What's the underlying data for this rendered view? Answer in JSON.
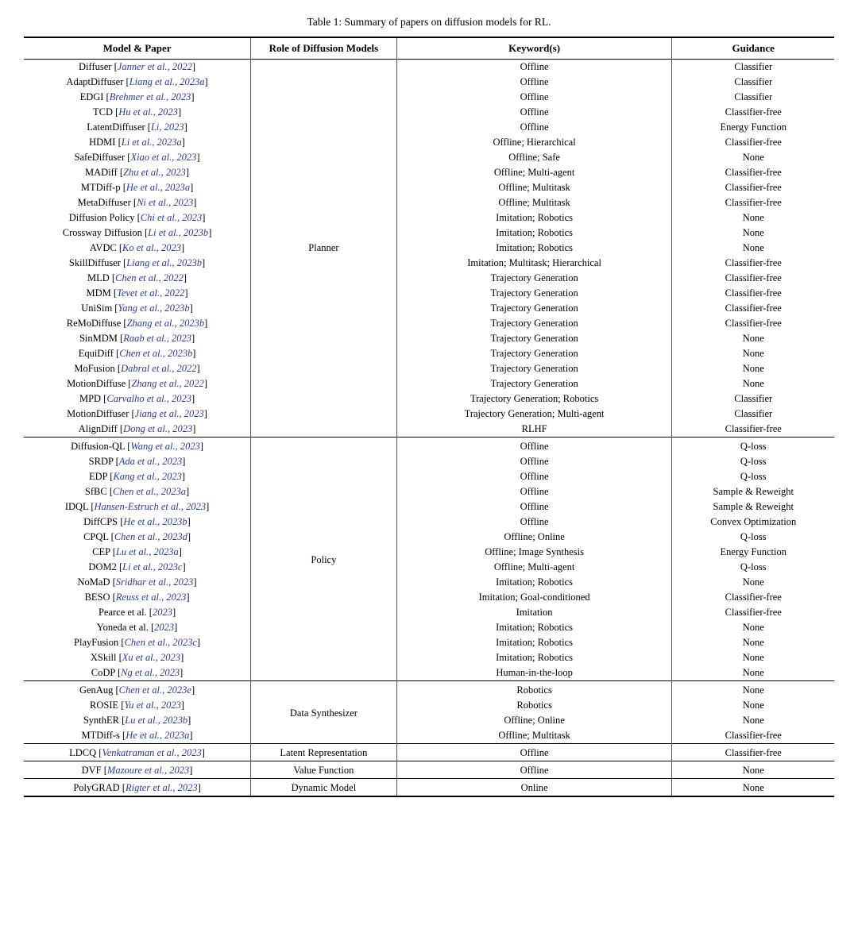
{
  "title": "Table 1: Summary of papers on diffusion models for RL.",
  "headers": {
    "model": "Model & Paper",
    "role": "Role of Diffusion Models",
    "keywords": "Keyword(s)",
    "guidance": "Guidance"
  },
  "sections": [
    {
      "role": "Planner",
      "rows": [
        {
          "model": "Diffuser [Janner et al., 2022]",
          "keywords": "Offline",
          "guidance": "Classifier"
        },
        {
          "model": "AdaptDiffuser [Liang et al., 2023a]",
          "keywords": "Offline",
          "guidance": "Classifier"
        },
        {
          "model": "EDGI [Brehmer et al., 2023]",
          "keywords": "Offline",
          "guidance": "Classifier"
        },
        {
          "model": "TCD [Hu et al., 2023]",
          "keywords": "Offline",
          "guidance": "Classifier-free"
        },
        {
          "model": "LatentDiffuser [Li, 2023]",
          "keywords": "Offline",
          "guidance": "Energy Function"
        },
        {
          "model": "HDMI [Li et al., 2023a]",
          "keywords": "Offline; Hierarchical",
          "guidance": "Classifier-free"
        },
        {
          "model": "SafeDiffuser [Xiao et al., 2023]",
          "keywords": "Offline; Safe",
          "guidance": "None"
        },
        {
          "model": "MADiff [Zhu et al., 2023]",
          "keywords": "Offline; Multi-agent",
          "guidance": "Classifier-free"
        },
        {
          "model": "MTDiff-p [He et al., 2023a]",
          "keywords": "Offline; Multitask",
          "guidance": "Classifier-free"
        },
        {
          "model": "MetaDiffuser [Ni et al., 2023]",
          "keywords": "Offline; Multitask",
          "guidance": "Classifier-free"
        },
        {
          "model": "Diffusion Policy [Chi et al., 2023]",
          "keywords": "Imitation; Robotics",
          "guidance": "None"
        },
        {
          "model": "Crossway Diffusion [Li et al., 2023b]",
          "keywords": "Imitation; Robotics",
          "guidance": "None"
        },
        {
          "model": "AVDC [Ko et al., 2023]",
          "keywords": "Imitation; Robotics",
          "guidance": "None"
        },
        {
          "model": "SkillDiffuser [Liang et al., 2023b]",
          "keywords": "Imitation; Multitask; Hierarchical",
          "guidance": "Classifier-free"
        },
        {
          "model": "MLD [Chen et al., 2022]",
          "keywords": "Trajectory Generation",
          "guidance": "Classifier-free"
        },
        {
          "model": "MDM [Tevet et al., 2022]",
          "keywords": "Trajectory Generation",
          "guidance": "Classifier-free"
        },
        {
          "model": "UniSim [Yang et al., 2023b]",
          "keywords": "Trajectory Generation",
          "guidance": "Classifier-free"
        },
        {
          "model": "ReMoDiffuse [Zhang et al., 2023b]",
          "keywords": "Trajectory Generation",
          "guidance": "Classifier-free"
        },
        {
          "model": "SinMDM [Raab et al., 2023]",
          "keywords": "Trajectory Generation",
          "guidance": "None"
        },
        {
          "model": "EquiDiff [Chen et al., 2023b]",
          "keywords": "Trajectory Generation",
          "guidance": "None"
        },
        {
          "model": "MoFusion [Dabral et al., 2022]",
          "keywords": "Trajectory Generation",
          "guidance": "None"
        },
        {
          "model": "MotionDiffuse [Zhang et al., 2022]",
          "keywords": "Trajectory Generation",
          "guidance": "None"
        },
        {
          "model": "MPD [Carvalho et al., 2023]",
          "keywords": "Trajectory Generation; Robotics",
          "guidance": "Classifier"
        },
        {
          "model": "MotionDiffuser [Jiang et al., 2023]",
          "keywords": "Trajectory Generation; Multi-agent",
          "guidance": "Classifier"
        },
        {
          "model": "AlignDiff [Dong et al., 2023]",
          "keywords": "RLHF",
          "guidance": "Classifier-free"
        }
      ]
    },
    {
      "role": "Policy",
      "rows": [
        {
          "model": "Diffusion-QL [Wang et al., 2023]",
          "keywords": "Offline",
          "guidance": "Q-loss"
        },
        {
          "model": "SRDP [Ada et al., 2023]",
          "keywords": "Offline",
          "guidance": "Q-loss"
        },
        {
          "model": "EDP [Kang et al., 2023]",
          "keywords": "Offline",
          "guidance": "Q-loss"
        },
        {
          "model": "SfBC [Chen et al., 2023a]",
          "keywords": "Offline",
          "guidance": "Sample & Reweight"
        },
        {
          "model": "IDQL [Hansen-Estruch et al., 2023]",
          "keywords": "Offline",
          "guidance": "Sample & Reweight"
        },
        {
          "model": "DiffCPS [He et al., 2023b]",
          "keywords": "Offline",
          "guidance": "Convex Optimization"
        },
        {
          "model": "CPQL [Chen et al., 2023d]",
          "keywords": "Offline; Online",
          "guidance": "Q-loss"
        },
        {
          "model": "CEP [Lu et al., 2023a]",
          "keywords": "Offline; Image Synthesis",
          "guidance": "Energy Function"
        },
        {
          "model": "DOM2 [Li et al., 2023c]",
          "keywords": "Offline; Multi-agent",
          "guidance": "Q-loss"
        },
        {
          "model": "NoMaD [Sridhar et al., 2023]",
          "keywords": "Imitation; Robotics",
          "guidance": "None"
        },
        {
          "model": "BESO [Reuss et al., 2023]",
          "keywords": "Imitation; Goal-conditioned",
          "guidance": "Classifier-free"
        },
        {
          "model": "Pearce et al. [2023]",
          "keywords": "Imitation",
          "guidance": "Classifier-free"
        },
        {
          "model": "Yoneda et al. [2023]",
          "keywords": "Imitation; Robotics",
          "guidance": "None"
        },
        {
          "model": "PlayFusion [Chen et al., 2023c]",
          "keywords": "Imitation; Robotics",
          "guidance": "None"
        },
        {
          "model": "XSkill [Xu et al., 2023]",
          "keywords": "Imitation; Robotics",
          "guidance": "None"
        },
        {
          "model": "CoDP [Ng et al., 2023]",
          "keywords": "Human-in-the-loop",
          "guidance": "None"
        }
      ]
    },
    {
      "role": "Data Synthesizer",
      "rows": [
        {
          "model": "GenAug [Chen et al., 2023e]",
          "keywords": "Robotics",
          "guidance": "None"
        },
        {
          "model": "ROSIE [Yu et al., 2023]",
          "keywords": "Robotics",
          "guidance": "None"
        },
        {
          "model": "SynthER [Lu et al., 2023b]",
          "keywords": "Offline; Online",
          "guidance": "None"
        },
        {
          "model": "MTDiff-s [He et al., 2023a]",
          "keywords": "Offline; Multitask",
          "guidance": "Classifier-free"
        }
      ]
    },
    {
      "role": "Latent Representation",
      "rows": [
        {
          "model": "LDCQ [Venkatraman et al., 2023]",
          "keywords": "Offline",
          "guidance": "Classifier-free"
        }
      ]
    },
    {
      "role": "Value Function",
      "rows": [
        {
          "model": "DVF [Mazoure et al., 2023]",
          "keywords": "Offline",
          "guidance": "None"
        }
      ]
    },
    {
      "role": "Dynamic Model",
      "rows": [
        {
          "model": "PolyGRAD [Rigter et al., 2023]",
          "keywords": "Online",
          "guidance": "None"
        }
      ]
    }
  ],
  "italic_names": [
    "Janner",
    "Liang",
    "Brehmer",
    "Hu",
    "Li",
    "Zhang",
    "Xiao",
    "Zhu",
    "He",
    "Ni",
    "Chi",
    "Ko",
    "Chen",
    "Tevet",
    "Yang",
    "Raab",
    "Dabral",
    "Jiang",
    "Carvalho",
    "Dong",
    "Wang",
    "Ada",
    "Kang",
    "Hansen-Estruch",
    "Kang",
    "Lu",
    "Sridhar",
    "Reuss",
    "Pearce",
    "Yoneda",
    "Xu",
    "Ng",
    "Yu",
    "Venkatraman",
    "Mazoure",
    "Rigter",
    "PlayFusion"
  ]
}
